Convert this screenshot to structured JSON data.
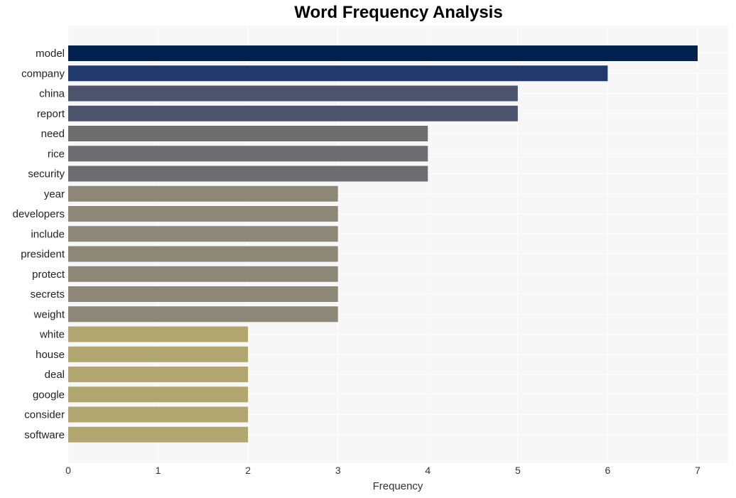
{
  "chart_data": {
    "type": "bar",
    "orientation": "horizontal",
    "title": "Word Frequency Analysis",
    "xlabel": "Frequency",
    "ylabel": "",
    "xlim": [
      0,
      7.35
    ],
    "x_ticks": [
      0,
      1,
      2,
      3,
      4,
      5,
      6,
      7
    ],
    "grid": true,
    "legend": "none",
    "categories": [
      "model",
      "company",
      "china",
      "report",
      "need",
      "rice",
      "security",
      "year",
      "developers",
      "include",
      "president",
      "protect",
      "secrets",
      "weight",
      "white",
      "house",
      "deal",
      "google",
      "consider",
      "software"
    ],
    "values": [
      7,
      6,
      5,
      5,
      4,
      4,
      4,
      3,
      3,
      3,
      3,
      3,
      3,
      3,
      2,
      2,
      2,
      2,
      2,
      2
    ],
    "colors": [
      "#00204e",
      "#233a6d",
      "#4b546c",
      "#4b546c",
      "#6e6e71",
      "#6e6e71",
      "#6e6e71",
      "#8c8776",
      "#8c8776",
      "#8c8776",
      "#8c8776",
      "#8c8776",
      "#8c8776",
      "#8c8776",
      "#b1a570",
      "#b1a570",
      "#b1a570",
      "#b1a570",
      "#b1a570",
      "#b1a570"
    ],
    "plot_background": "#f7f7f7"
  }
}
